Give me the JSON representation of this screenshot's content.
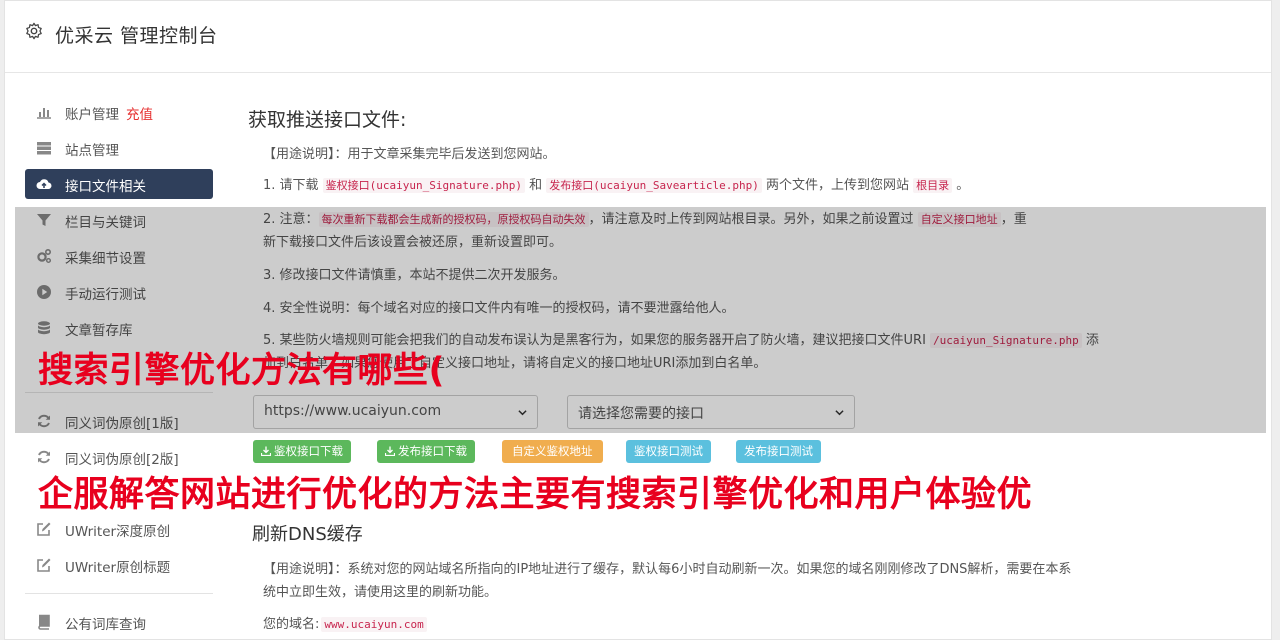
{
  "app": {
    "title": "优采云 管理控制台"
  },
  "sidebar": {
    "items": [
      {
        "label": "账户管理",
        "extra": "充值"
      },
      {
        "label": "站点管理"
      },
      {
        "label": "接口文件相关"
      },
      {
        "label": "栏目与关键词"
      },
      {
        "label": "采集细节设置"
      },
      {
        "label": "手动运行测试"
      },
      {
        "label": "文章暂存库"
      },
      {
        "label": "同义词伪原创[1版]"
      },
      {
        "label": "同义词伪原创[2版]"
      },
      {
        "label": "UWriter深度原创"
      },
      {
        "label": "UWriter原创标题"
      },
      {
        "label": "公有词库查询"
      }
    ]
  },
  "main": {
    "section1": {
      "title": "获取推送接口文件:",
      "usage": "【用途说明】：用于文章采集完毕后发送到您网站。",
      "step1": {
        "a": "1. 请下载 ",
        "code1": "鉴权接口(ucaiyun_Signature.php)",
        "b": " 和 ",
        "code2": "发布接口(ucaiyun_Savearticle.php)",
        "c": " 两个文件，上传到您网站 ",
        "code3": "根目录",
        "d": " 。"
      },
      "step2": {
        "a": "2. 注意：",
        "code1": "每次重新下载都会生成新的授权码，原授权码自动失效",
        "b": "，请注意及时上传到网站根目录。另外，如果之前设置过 ",
        "code2": "自定义接口地址",
        "c": "，重",
        "d": "新下载接口文件后该设置会被还原，重新设置即可。"
      },
      "step3": "3. 修改接口文件请慎重，本站不提供二次开发服务。",
      "step4": "4. 安全性说明：每个域名对应的接口文件内有唯一的授权码，请不要泄露给他人。",
      "step5": {
        "a": "5. 某些防火墙规则可能会把我们的自动发布误认为是黑客行为，如果您的服务器开启了防火墙，建议把接口文件URI ",
        "code1": "/ucaiyun_Signature.php",
        "b": " 添",
        "c": "加到白名单，如果您使用了自定义接口地址，请将自定义的接口地址URI添加到白名单。"
      },
      "url_select": "https://www.ucaiyun.com",
      "iface_select": "请选择您需要的接口",
      "buttons": {
        "dl_sig": "鉴权接口下载",
        "dl_pub": "发布接口下载",
        "custom": "自定义鉴权地址",
        "test_sig": "鉴权接口测试",
        "test_pub": "发布接口测试"
      }
    },
    "section2": {
      "title": "刷新DNS缓存",
      "usage_a": "【用途说明】：系统对您的网站域名所指向的IP地址进行了缓存，默认每6小时自动刷新一次。如果您的域名刚刚修改了DNS解析，需要在本系",
      "usage_b": "统中立即生效，请使用这里的刷新功能。",
      "domain_label": "您的域名:",
      "domain_value": "www.ucaiyun.com"
    }
  },
  "ad": {
    "line1": "搜索引擎优化方法有哪些(",
    "line2": "企服解答网站进行优化的方法主要有搜索引擎优化和用户体验优"
  },
  "colors": {
    "active_bg": "#2f3f5b",
    "green": "#5cb85c",
    "orange": "#f0ad4e",
    "blue": "#5bc0de",
    "ad_red": "#e8001e",
    "recharge": "#e62f2f"
  }
}
